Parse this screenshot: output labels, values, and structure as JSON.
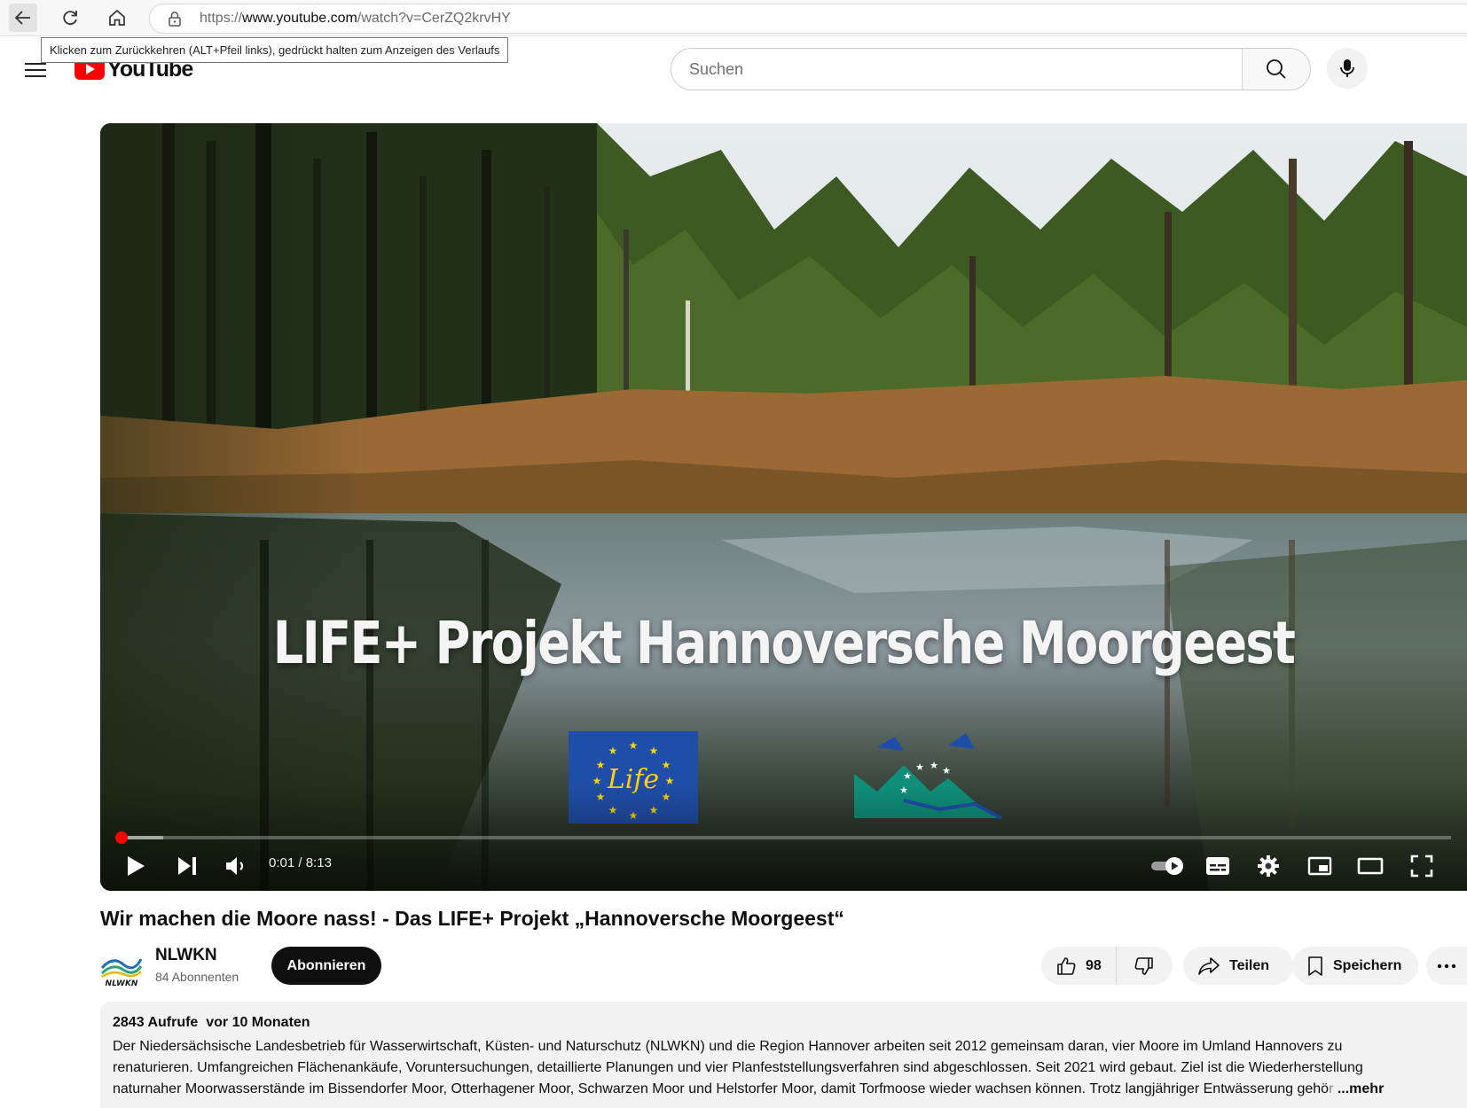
{
  "browser": {
    "url_prefix": "https://",
    "url_domain": "www.youtube.com",
    "url_path": "/watch?v=CerZQ2krvHY",
    "tooltip": "Klicken zum Zurückkehren (ALT+Pfeil links), gedrückt halten zum Anzeigen des Verlaufs"
  },
  "header": {
    "logo_text": "YouTube",
    "search_placeholder": "Suchen"
  },
  "player": {
    "overlay_title": "LIFE+ Projekt Hannoversche Moorgeest",
    "life_logo_text": "Life",
    "time_current": "0:01",
    "time_separator": " / ",
    "time_total": "8:13",
    "progress_played_fraction": 0.004,
    "progress_buffered_fraction": 0.035,
    "accent": "#ff0000"
  },
  "video": {
    "title": "Wir machen die Moore nass! - Das LIFE+ Projekt „Hannoversche Moorgeest“",
    "channel_name": "NLWKN",
    "channel_logo_text": "NLWKN",
    "subscribers": "84 Abonnenten",
    "subscribe_label": "Abonnieren",
    "likes": "98",
    "share_label": "Teilen",
    "save_label": "Speichern"
  },
  "description": {
    "meta": "2843 Aufrufe  vor 10 Monaten",
    "line1": "Der Niedersächsische Landesbetrieb für Wasserwirtschaft, Küsten- und Naturschutz (NLWKN) und die Region Hannover arbeiten seit 2012 gemeinsam daran, vier Moore im Umland Hannovers zu",
    "line2": "renaturieren. Umfangreichen Flächenankäufe, Voruntersuchungen, detaillierte Planungen und vier Planfeststellungsverfahren sind abgeschlossen. Seit 2021 wird gebaut. Ziel ist die Wiederherstellung",
    "line3": "naturnaher Moorwasserstände im Bissendorfer Moor, Otterhagener Moor, Schwarzen Moor und Helstorfer Moor, damit Torfmoose wieder wachsen können. Trotz langjähriger Entwässerung gehö",
    "line3_fade": "r",
    "more_label": "...mehr"
  }
}
